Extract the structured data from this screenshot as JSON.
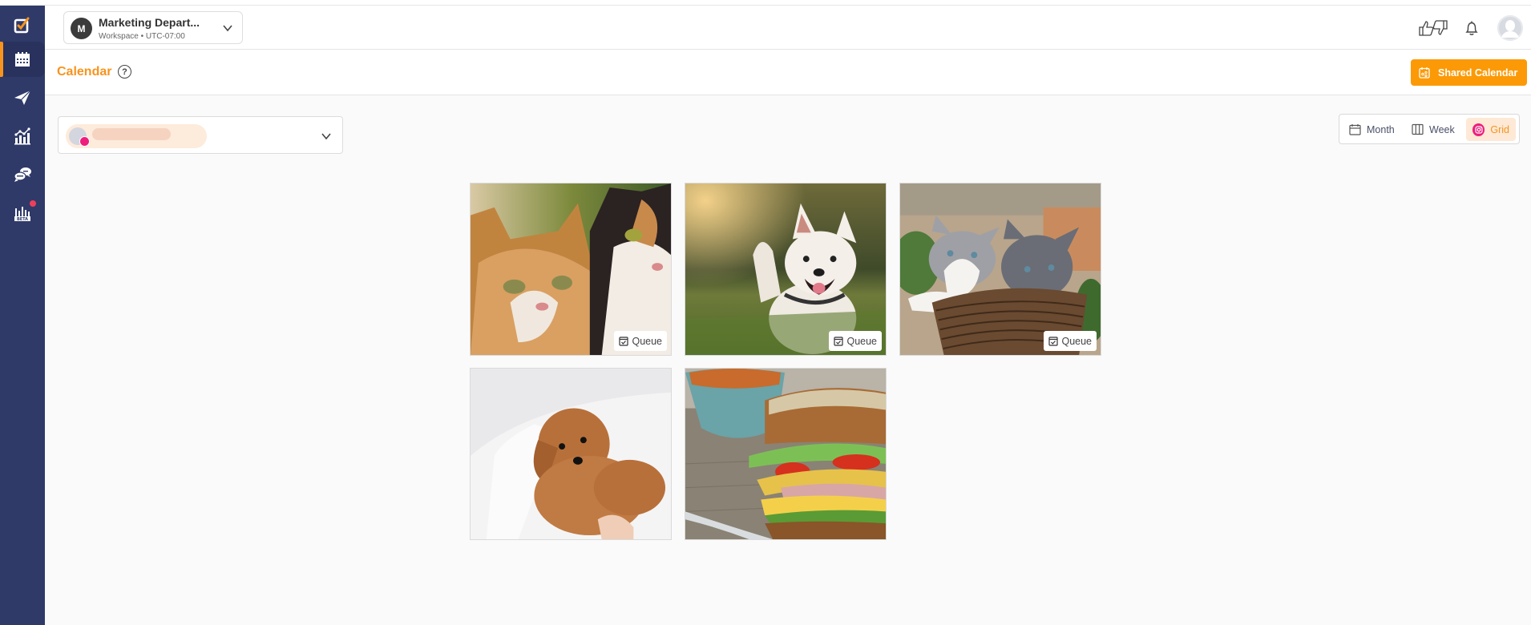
{
  "workspace": {
    "initial": "M",
    "name": "Marketing Depart...",
    "subtitle": "Workspace • UTC-07:00"
  },
  "sidebar": {
    "items": [
      {
        "name": "compose",
        "icon": "checkbox-pencil-icon",
        "active": false
      },
      {
        "name": "calendar",
        "icon": "calendar-icon",
        "active": true
      },
      {
        "name": "publish",
        "icon": "paper-plane-icon",
        "active": false
      },
      {
        "name": "analytics",
        "icon": "bar-chart-icon",
        "active": false
      },
      {
        "name": "engage",
        "icon": "chat-bubbles-icon",
        "active": false
      },
      {
        "name": "reports-beta",
        "icon": "beta-chart-icon",
        "active": false,
        "badge": "BETA",
        "notification": true
      }
    ]
  },
  "header": {
    "icons": [
      "thumbs-up-down-icon",
      "bell-icon",
      "user-avatar"
    ]
  },
  "page": {
    "title": "Calendar",
    "help": "?",
    "shared_calendar_label": "Shared Calendar"
  },
  "account_selector": {
    "network": "instagram",
    "name_redacted": true
  },
  "views": {
    "items": [
      {
        "label": "Month",
        "icon": "calendar-month-icon",
        "active": false
      },
      {
        "label": "Week",
        "icon": "columns-icon",
        "active": false
      },
      {
        "label": "Grid",
        "icon": "instagram-icon",
        "active": true
      }
    ]
  },
  "grid": {
    "posts": [
      {
        "subject": "two cats (tabby and calico)",
        "status": "Queue"
      },
      {
        "subject": "white dog running on grass",
        "status": "Queue"
      },
      {
        "subject": "two kittens in a wicker basket",
        "status": "Queue"
      },
      {
        "subject": "fluffy brown puppy on white sheets",
        "status": null
      },
      {
        "subject": "sandwich with bowl of fries",
        "status": null
      }
    ]
  },
  "colors": {
    "sidebar": "#2f3a69",
    "accent": "#f7941d",
    "button": "#fb9a06",
    "instagram": "#ee1e7c"
  }
}
